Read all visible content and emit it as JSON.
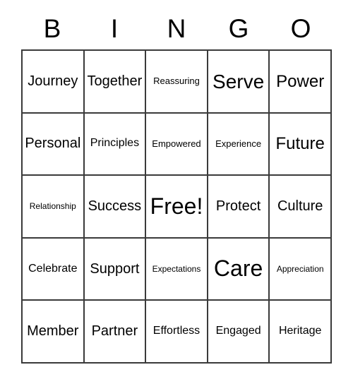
{
  "card": {
    "header_letters": [
      "B",
      "I",
      "N",
      "G",
      "O"
    ],
    "free_space_label": "Free!",
    "rows": [
      [
        {
          "text": "Journey",
          "size": "md"
        },
        {
          "text": "Together",
          "size": "md"
        },
        {
          "text": "Reassuring",
          "size": "xs"
        },
        {
          "text": "Serve",
          "size": "xl"
        },
        {
          "text": "Power",
          "size": "lg"
        }
      ],
      [
        {
          "text": "Personal",
          "size": "md"
        },
        {
          "text": "Principles",
          "size": "sm"
        },
        {
          "text": "Empowered",
          "size": "xs"
        },
        {
          "text": "Experience",
          "size": "xs"
        },
        {
          "text": "Future",
          "size": "lg"
        }
      ],
      [
        {
          "text": "Relationship",
          "size": "xxs"
        },
        {
          "text": "Success",
          "size": "md"
        },
        {
          "text": "Free!",
          "size": "xxl"
        },
        {
          "text": "Protect",
          "size": "md"
        },
        {
          "text": "Culture",
          "size": "md"
        }
      ],
      [
        {
          "text": "Celebrate",
          "size": "sm"
        },
        {
          "text": "Support",
          "size": "md"
        },
        {
          "text": "Expectations",
          "size": "xxs"
        },
        {
          "text": "Care",
          "size": "xxl"
        },
        {
          "text": "Appreciation",
          "size": "xxs"
        }
      ],
      [
        {
          "text": "Member",
          "size": "md"
        },
        {
          "text": "Partner",
          "size": "md"
        },
        {
          "text": "Effortless",
          "size": "sm"
        },
        {
          "text": "Engaged",
          "size": "sm"
        },
        {
          "text": "Heritage",
          "size": "sm"
        }
      ]
    ]
  },
  "colors": {
    "background": "#ffffff",
    "text": "#000000",
    "grid_line": "#3a3a3a"
  }
}
